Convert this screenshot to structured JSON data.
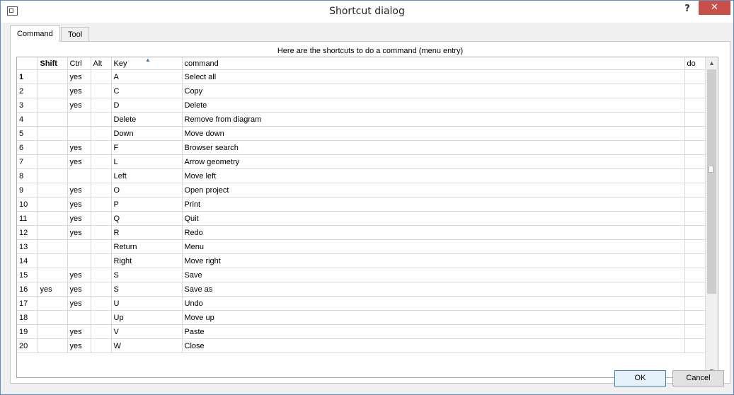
{
  "window": {
    "title": "Shortcut dialog",
    "help_label": "?",
    "close_label": "✕"
  },
  "tabs": [
    {
      "label": "Command"
    },
    {
      "label": "Tool"
    }
  ],
  "caption": "Here are the shortcuts to do a command (menu entry)",
  "columns": {
    "row": "",
    "shift": "Shift",
    "ctrl": "Ctrl",
    "alt": "Alt",
    "key": "Key",
    "command": "command",
    "do": "do"
  },
  "rows": [
    {
      "n": "1",
      "shift": "",
      "ctrl": "yes",
      "alt": "",
      "key": "A",
      "command": "Select all"
    },
    {
      "n": "2",
      "shift": "",
      "ctrl": "yes",
      "alt": "",
      "key": "C",
      "command": "Copy"
    },
    {
      "n": "3",
      "shift": "",
      "ctrl": "yes",
      "alt": "",
      "key": "D",
      "command": "Delete"
    },
    {
      "n": "4",
      "shift": "",
      "ctrl": "",
      "alt": "",
      "key": "Delete",
      "command": "Remove from diagram"
    },
    {
      "n": "5",
      "shift": "",
      "ctrl": "",
      "alt": "",
      "key": "Down",
      "command": "Move down"
    },
    {
      "n": "6",
      "shift": "",
      "ctrl": "yes",
      "alt": "",
      "key": "F",
      "command": "Browser search"
    },
    {
      "n": "7",
      "shift": "",
      "ctrl": "yes",
      "alt": "",
      "key": "L",
      "command": "Arrow geometry"
    },
    {
      "n": "8",
      "shift": "",
      "ctrl": "",
      "alt": "",
      "key": "Left",
      "command": "Move left"
    },
    {
      "n": "9",
      "shift": "",
      "ctrl": "yes",
      "alt": "",
      "key": "O",
      "command": "Open project"
    },
    {
      "n": "10",
      "shift": "",
      "ctrl": "yes",
      "alt": "",
      "key": "P",
      "command": "Print"
    },
    {
      "n": "11",
      "shift": "",
      "ctrl": "yes",
      "alt": "",
      "key": "Q",
      "command": "Quit"
    },
    {
      "n": "12",
      "shift": "",
      "ctrl": "yes",
      "alt": "",
      "key": "R",
      "command": "Redo"
    },
    {
      "n": "13",
      "shift": "",
      "ctrl": "",
      "alt": "",
      "key": "Return",
      "command": "Menu"
    },
    {
      "n": "14",
      "shift": "",
      "ctrl": "",
      "alt": "",
      "key": "Right",
      "command": "Move right"
    },
    {
      "n": "15",
      "shift": "",
      "ctrl": "yes",
      "alt": "",
      "key": "S",
      "command": "Save"
    },
    {
      "n": "16",
      "shift": "yes",
      "ctrl": "yes",
      "alt": "",
      "key": "S",
      "command": "Save as"
    },
    {
      "n": "17",
      "shift": "",
      "ctrl": "yes",
      "alt": "",
      "key": "U",
      "command": "Undo"
    },
    {
      "n": "18",
      "shift": "",
      "ctrl": "",
      "alt": "",
      "key": "Up",
      "command": "Move up"
    },
    {
      "n": "19",
      "shift": "",
      "ctrl": "yes",
      "alt": "",
      "key": "V",
      "command": "Paste"
    },
    {
      "n": "20",
      "shift": "",
      "ctrl": "yes",
      "alt": "",
      "key": "W",
      "command": "Close"
    }
  ],
  "buttons": {
    "ok": "OK",
    "cancel": "Cancel"
  },
  "colors": {
    "title_bar_border": "#5a8fc7",
    "close_button": "#c7504a",
    "ok_border": "#3c7fb1"
  }
}
